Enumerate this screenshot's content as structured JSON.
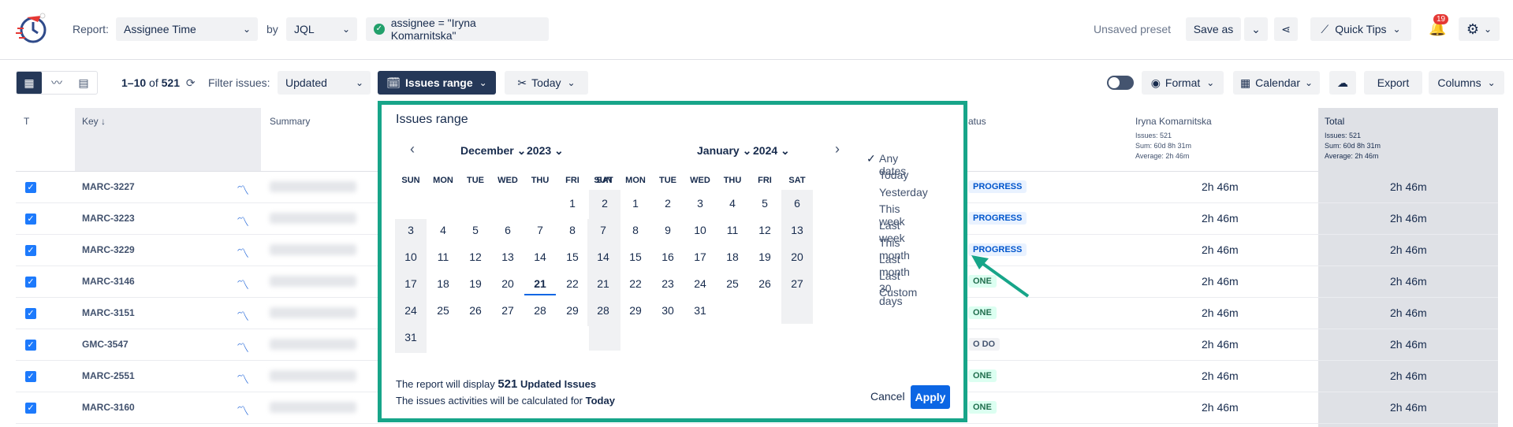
{
  "header": {
    "report_label": "Report:",
    "report_value": "Assignee Time",
    "by_label": "by",
    "by_value": "JQL",
    "jql_value": "assignee = \"Iryna Komarnitska\"",
    "unsaved": "Unsaved preset",
    "save_as": "Save as",
    "quick_tips": "Quick Tips",
    "notif_count": "19"
  },
  "toolbar": {
    "range": "1–10",
    "of": " of ",
    "total": "521",
    "filter_label": "Filter issues:",
    "filter_value": "Updated",
    "issues_range": "Issues range",
    "today": "Today",
    "format": "Format",
    "calendar": "Calendar",
    "export": "Export",
    "columns": "Columns"
  },
  "table": {
    "headers": {
      "t": "T",
      "key": "Key ↓",
      "summary": "Summary",
      "status": "atus",
      "assignee": "Iryna Komarnitska",
      "assignee_issues": "Issues: 521",
      "assignee_sum": "Sum: 60d 8h 31m",
      "assignee_avg": "Average: 2h 46m",
      "total": "Total",
      "total_issues": "Issues: 521",
      "total_sum": "Sum: 60d 8h 31m",
      "total_avg": "Average: 2h 46m"
    },
    "rows": [
      {
        "key": "MARC-3227",
        "status": "PROGRESS",
        "v1": "2h 46m",
        "v2": "2h 46m"
      },
      {
        "key": "MARC-3223",
        "status": "PROGRESS",
        "v1": "2h 46m",
        "v2": "2h 46m"
      },
      {
        "key": "MARC-3229",
        "status": "PROGRESS",
        "v1": "2h 46m",
        "v2": "2h 46m"
      },
      {
        "key": "MARC-3146",
        "status": "ONE",
        "v1": "2h 46m",
        "v2": "2h 46m"
      },
      {
        "key": "MARC-3151",
        "status": "ONE",
        "v1": "2h 46m",
        "v2": "2h 46m"
      },
      {
        "key": "GMC-3547",
        "status": "O DO",
        "v1": "2h 46m",
        "v2": "2h 46m"
      },
      {
        "key": "MARC-2551",
        "status": "ONE",
        "v1": "2h 46m",
        "v2": "2h 46m"
      },
      {
        "key": "MARC-3160",
        "status": "ONE",
        "v1": "2h 46m",
        "v2": "2h 46m"
      }
    ]
  },
  "popup": {
    "title": "Issues range",
    "left_month": "December",
    "left_year": "2023",
    "right_month": "January",
    "right_year": "2024",
    "dow": [
      "SUN",
      "MON",
      "TUE",
      "WED",
      "THU",
      "FRI",
      "SAT"
    ],
    "dec_days": [
      "1",
      "2",
      "3",
      "4",
      "5",
      "6",
      "7",
      "8",
      "9",
      "10",
      "11",
      "12",
      "13",
      "14",
      "15",
      "16",
      "17",
      "18",
      "19",
      "20",
      "21",
      "22",
      "23",
      "24",
      "25",
      "26",
      "27",
      "28",
      "29",
      "30",
      "31"
    ],
    "jan_days": [
      "1",
      "2",
      "3",
      "4",
      "5",
      "6",
      "7",
      "8",
      "9",
      "10",
      "11",
      "12",
      "13",
      "14",
      "15",
      "16",
      "17",
      "18",
      "19",
      "20",
      "21",
      "22",
      "23",
      "24",
      "25",
      "26",
      "27",
      "28",
      "29",
      "30",
      "31"
    ],
    "options": [
      "Any dates",
      "Today",
      "Yesterday",
      "This week",
      "Last week",
      "This month",
      "Last month",
      "Last 30 days",
      "Custom"
    ],
    "footer1_prefix": "The report will display ",
    "footer1_count": "521",
    "footer1_suffix": " Updated Issues",
    "footer2_prefix": "The issues activities will be calculated for ",
    "footer2_value": "Today",
    "cancel": "Cancel",
    "apply": "Apply"
  },
  "colors": {
    "accent": "#17a589",
    "primary": "#0c66e4",
    "dark": "#253858"
  }
}
